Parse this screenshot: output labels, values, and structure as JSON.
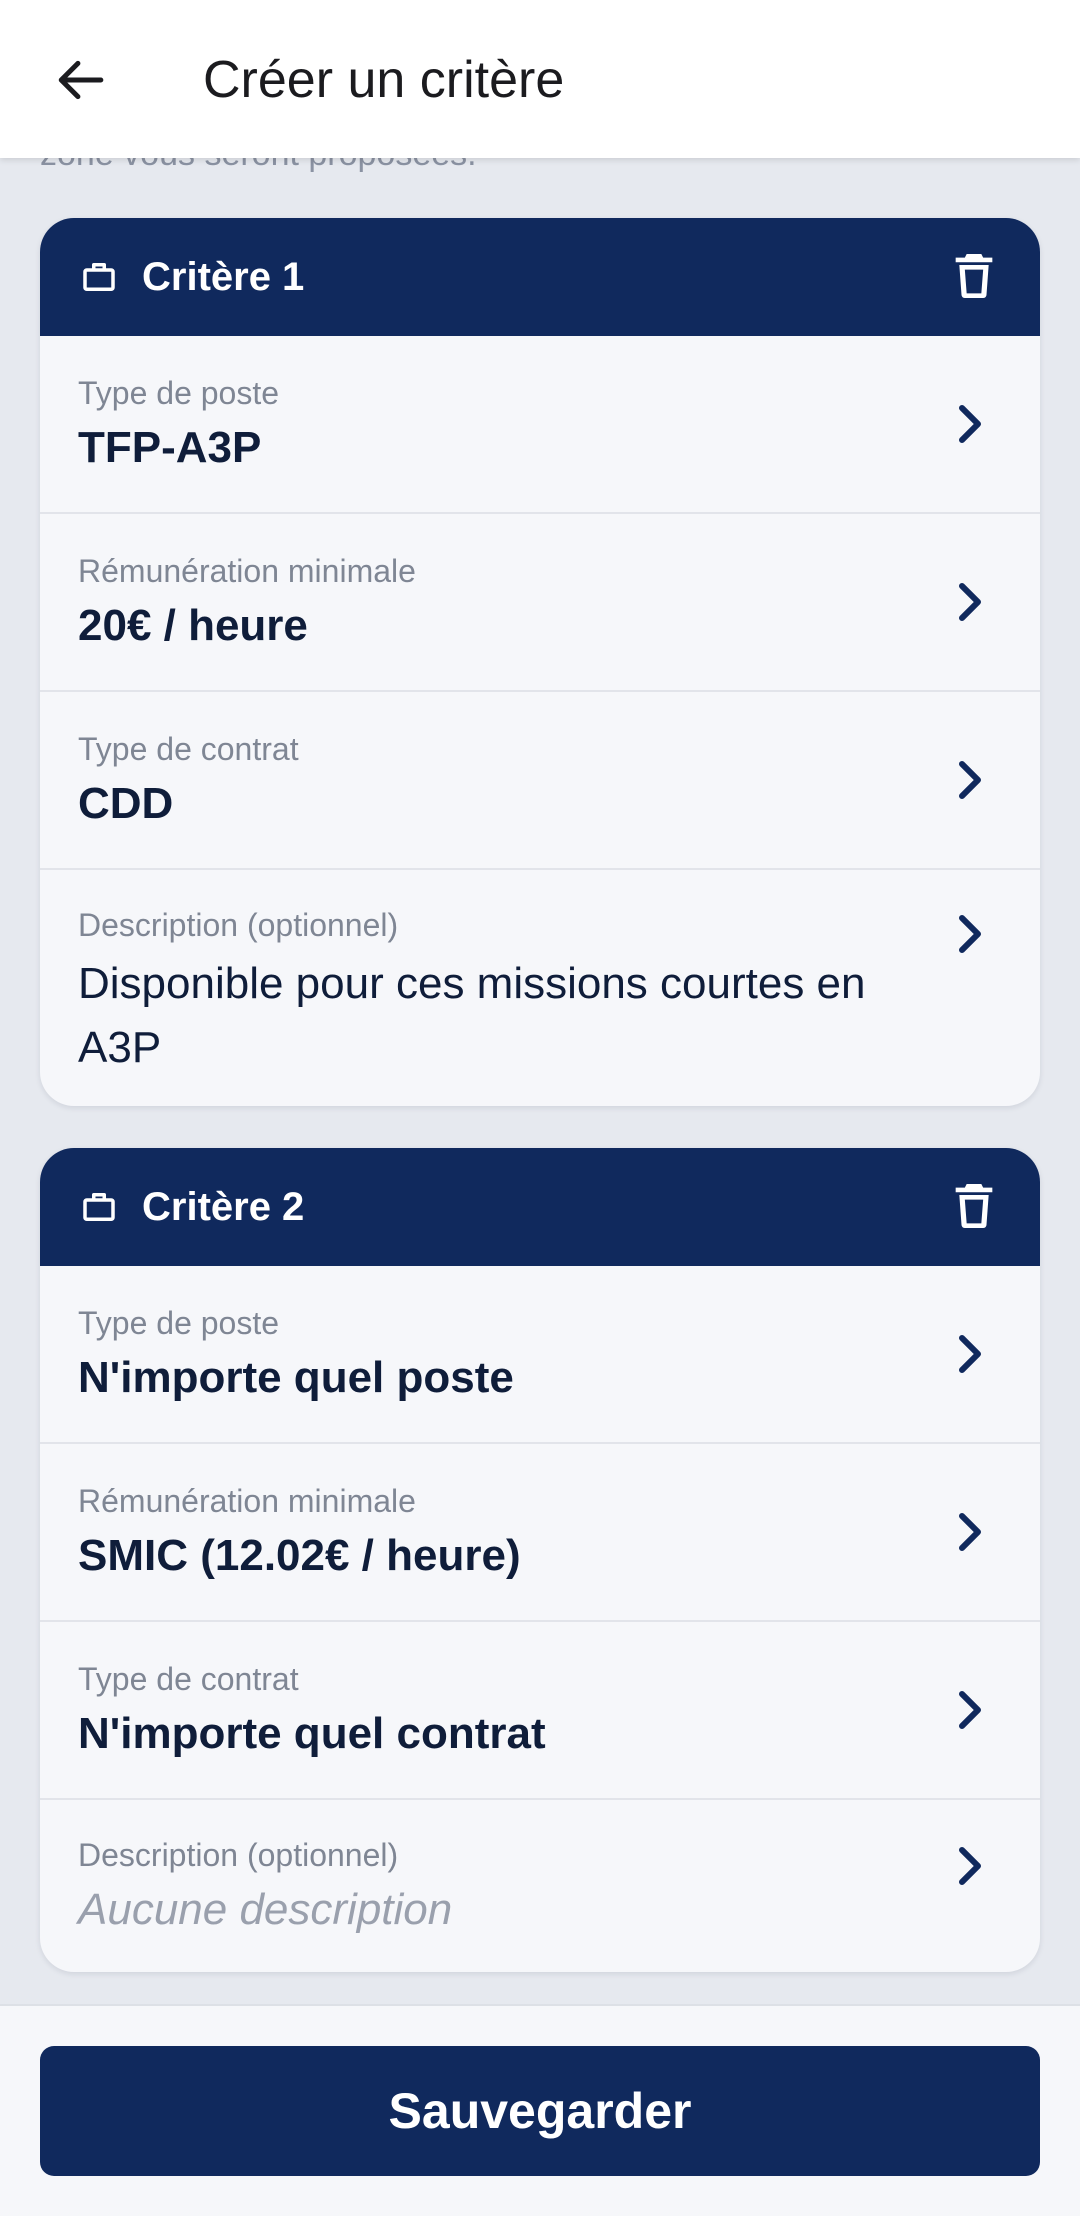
{
  "header": {
    "title": "Créer un critère",
    "back_icon": "arrow-left-icon"
  },
  "intro_text": "zone vous seront proposées.",
  "criteria": [
    {
      "title": "Critère 1",
      "rows": [
        {
          "label": "Type de poste",
          "value": "TFP-A3P"
        },
        {
          "label": "Rémunération minimale",
          "value": "20€ / heure"
        },
        {
          "label": "Type de contrat",
          "value": "CDD"
        },
        {
          "label": "Description (optionnel)",
          "value": "Disponible pour ces missions courtes en A3P"
        }
      ]
    },
    {
      "title": "Critère 2",
      "rows": [
        {
          "label": "Type de poste",
          "value": "N'importe quel poste"
        },
        {
          "label": "Rémunération minimale",
          "value": "SMIC (12.02€ / heure)"
        },
        {
          "label": "Type de contrat",
          "value": "N'importe quel contrat"
        },
        {
          "label": "Description (optionnel)",
          "value": "Aucune description"
        }
      ]
    }
  ],
  "footer": {
    "save_label": "Sauvegarder"
  },
  "colors": {
    "primary": "#10295d",
    "background": "#e6e9ef",
    "card": "#f6f7fa"
  }
}
